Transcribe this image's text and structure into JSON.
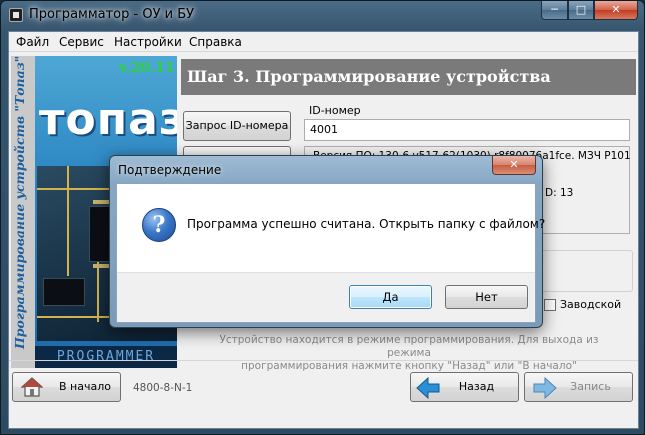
{
  "window": {
    "title": "Программатор - ОУ и БУ",
    "min_glyph": "─",
    "max_glyph": "□",
    "close_glyph": "✕"
  },
  "menu": {
    "items": [
      "Файл",
      "Сервис",
      "Настройки",
      "Справка"
    ]
  },
  "banner": {
    "vertical_text": "Программирование устройств \"Топаз\"",
    "version": "v.20.11",
    "logo": "топаз",
    "footer": "PROGRAMMER"
  },
  "step": {
    "title": "Шаг 3. Программирование устройства"
  },
  "id_request": {
    "button_label": "Запрос ID-номера",
    "field_label": "ID-номер",
    "field_value": "4001"
  },
  "info": {
    "firmware_line": "Версия ПО: 130-6 v517-62(1030) r8f80076a1fce. МЗЧ Р101",
    "right_value": "D: 13"
  },
  "factory_checkbox": {
    "label": "Заводской",
    "checked": false
  },
  "status": {
    "line1": "Устройство находится в режиме программирования. Для выхода из режима",
    "line2": "программирования нажмите кнопку \"Назад\" или \"В начало\""
  },
  "bottom": {
    "home_label": "В начало",
    "device_code": "4800-8-N-1",
    "back_label": "Назад",
    "write_label": "Запись"
  },
  "dialog": {
    "title": "Подтверждение",
    "message": "Программа успешно считана. Открыть папку с файлом?",
    "icon_glyph": "?",
    "close_glyph": "✕",
    "yes_label": "Да",
    "no_label": "Нет"
  },
  "colors": {
    "accent_blue": "#3c7fb1",
    "step_header": "#7a7a7a",
    "version_green": "#2dd13a",
    "nav_arrow": "#2b8fd6"
  }
}
